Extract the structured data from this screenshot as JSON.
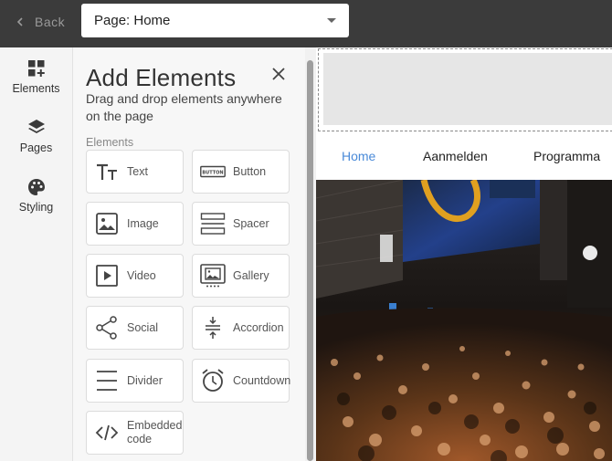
{
  "topbar": {
    "back_label": "Back",
    "page_select_value": "Page: Home"
  },
  "rail": {
    "items": [
      {
        "label": "Elements",
        "icon": "grid-plus-icon"
      },
      {
        "label": "Pages",
        "icon": "layers-icon"
      },
      {
        "label": "Styling",
        "icon": "palette-icon"
      }
    ]
  },
  "panel": {
    "title": "Add Elements",
    "subtitle": "Drag and drop elements anywhere on the page",
    "section_label": "Elements",
    "elements": [
      {
        "label": "Text",
        "icon": "text-icon"
      },
      {
        "label": "Button",
        "icon": "button-icon"
      },
      {
        "label": "Image",
        "icon": "image-icon"
      },
      {
        "label": "Spacer",
        "icon": "spacer-icon"
      },
      {
        "label": "Video",
        "icon": "video-icon"
      },
      {
        "label": "Gallery",
        "icon": "gallery-icon"
      },
      {
        "label": "Social",
        "icon": "share-icon"
      },
      {
        "label": "Accordion",
        "icon": "accordion-icon"
      },
      {
        "label": "Divider",
        "icon": "divider-icon"
      },
      {
        "label": "Countdown",
        "icon": "alarm-clock-icon"
      },
      {
        "label": "Embedded code",
        "icon": "code-icon"
      }
    ],
    "button_icon_text": "BUTTON"
  },
  "preview": {
    "nav": [
      "Home",
      "Aanmelden",
      "Programma"
    ],
    "active_nav": "Home",
    "accent_color": "#4a8ad8"
  }
}
